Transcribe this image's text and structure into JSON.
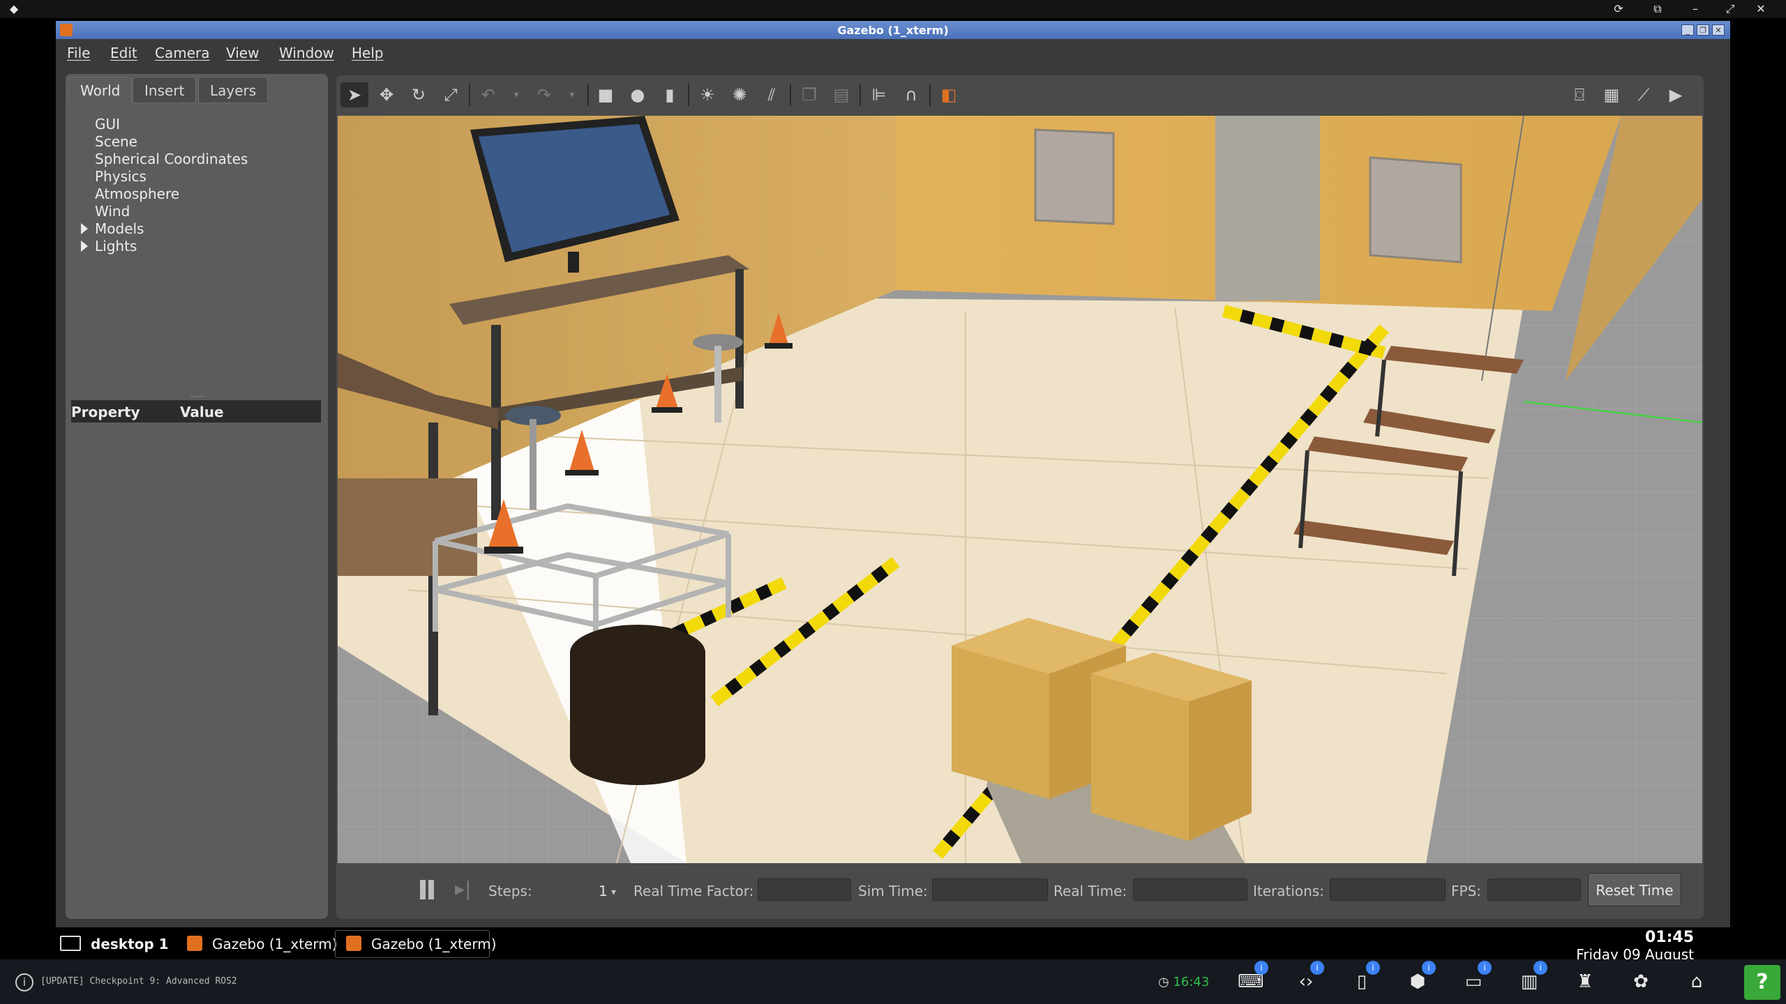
{
  "window": {
    "title": "Gazebo (1_xterm)",
    "controls": [
      "minimize",
      "restore",
      "close"
    ]
  },
  "menubar": {
    "items": [
      "File",
      "Edit",
      "Camera",
      "View",
      "Window",
      "Help"
    ]
  },
  "left_panel": {
    "tabs": [
      "World",
      "Insert",
      "Layers"
    ],
    "active_tab": "World",
    "tree_items": [
      "GUI",
      "Scene",
      "Spherical Coordinates",
      "Physics",
      "Atmosphere",
      "Wind",
      "Models",
      "Lights"
    ],
    "property_header": "Property",
    "value_header": "Value"
  },
  "toolbar": {
    "tools": [
      "select-arrow-icon",
      "translate-icon",
      "rotate-icon",
      "scale-icon",
      "undo-icon",
      "redo-icon",
      "box-icon",
      "sphere-icon",
      "cylinder-icon",
      "point-light-icon",
      "spot-light-icon",
      "directional-light-icon",
      "copy-icon",
      "paste-icon",
      "align-icon",
      "snap-icon",
      "view-angle-icon",
      "screenshot-icon",
      "log-icon",
      "plot-icon",
      "record-video-icon"
    ]
  },
  "bottom_bar": {
    "steps_label": "Steps:",
    "steps_value": "1",
    "real_time_factor_label": "Real Time Factor:",
    "sim_time_label": "Sim Time:",
    "real_time_label": "Real Time:",
    "iterations_label": "Iterations:",
    "fps_label": "FPS:",
    "reset_time_label": "Reset Time"
  },
  "taskbar": {
    "desktop_label": "desktop 1",
    "tasks": [
      "Gazebo (1_xterm)",
      "Gazebo (1_xterm)"
    ],
    "clock_time": "01:45",
    "clock_date": "Friday 09 August"
  },
  "platform_bar": {
    "status_text": "[UPDATE] Checkpoint 9: Advanced ROS2",
    "timer": "16:43",
    "badge_value": "i",
    "help_label": "?"
  },
  "colors": {
    "accent_titlebar": "#5a80c4",
    "help_green": "#38a838",
    "badge_blue": "#3b82f6",
    "timer_green": "#2fbf4a"
  }
}
